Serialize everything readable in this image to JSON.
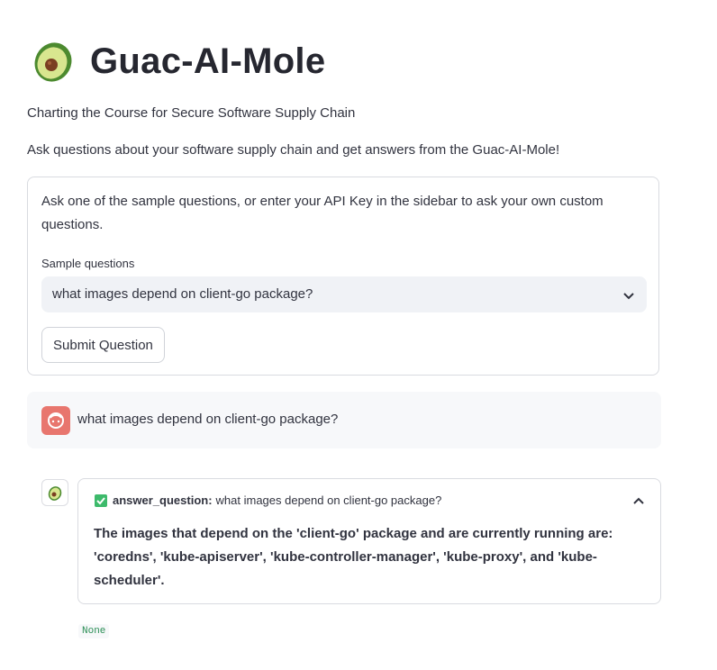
{
  "app": {
    "title": "Guac-AI-Mole",
    "logo_icon": "avocado-icon"
  },
  "subtitle": "Charting the Course for Secure Software Supply Chain",
  "intro": "Ask questions about your software supply chain and get answers from the Guac-AI-Mole!",
  "form": {
    "instructions": "Ask one of the sample questions, or enter your API Key in the sidebar to ask your own custom questions.",
    "select_label": "Sample questions",
    "selected_question": "what images depend on client-go package?",
    "submit_label": "Submit Question"
  },
  "chat": {
    "user_message": "what images depend on client-go package?",
    "tool_call": {
      "status_icon": "check-icon",
      "tool_name": "answer_question:",
      "tool_input": "what images depend on client-go package?",
      "answer": "The images that depend on the 'client-go' package and are currently running are: 'coredns', 'kube-apiserver', 'kube-controller-manager', 'kube-proxy', and 'kube-scheduler'."
    },
    "result_badge": "None"
  },
  "colors": {
    "user_avatar": "#e8766e",
    "check": "#3dba6b",
    "avocado_skin": "#5a9d3b",
    "avocado_flesh": "#d8e68f",
    "avocado_pit": "#7a3f22"
  }
}
